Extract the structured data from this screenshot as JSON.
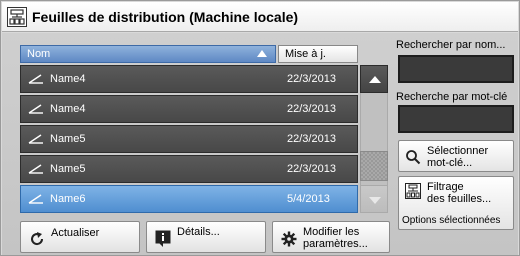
{
  "window": {
    "title": "Feuilles de distribution (Machine locale)",
    "icon": "distribution-sheet-icon"
  },
  "list": {
    "columns": {
      "name": "Nom",
      "date": "Mise à j."
    },
    "sort": "ascending",
    "rows": [
      {
        "name": "Name4",
        "date": "22/3/2013",
        "selected": false
      },
      {
        "name": "Name4",
        "date": "22/3/2013",
        "selected": false
      },
      {
        "name": "Name5",
        "date": "22/3/2013",
        "selected": false
      },
      {
        "name": "Name5",
        "date": "22/3/2013",
        "selected": false
      },
      {
        "name": "Name6",
        "date": "5/4/2013",
        "selected": true
      }
    ]
  },
  "side": {
    "search_name_label": "Rechercher par nom...",
    "search_keyword_label": "Recherche par mot-clé",
    "select_keyword_button": "Sélectionner\nmot-clé...",
    "filter_button": "Filtrage\ndes feuilles...",
    "filter_status": "Options sélectionnées"
  },
  "bottom": {
    "refresh": "Actualiser",
    "details": "Détails...",
    "modify": "Modifier les\nparamètres..."
  },
  "colors": {
    "selected_row": "#4f8ed0",
    "row": "#4a4a4a",
    "header_sort": "#5e88c4"
  }
}
